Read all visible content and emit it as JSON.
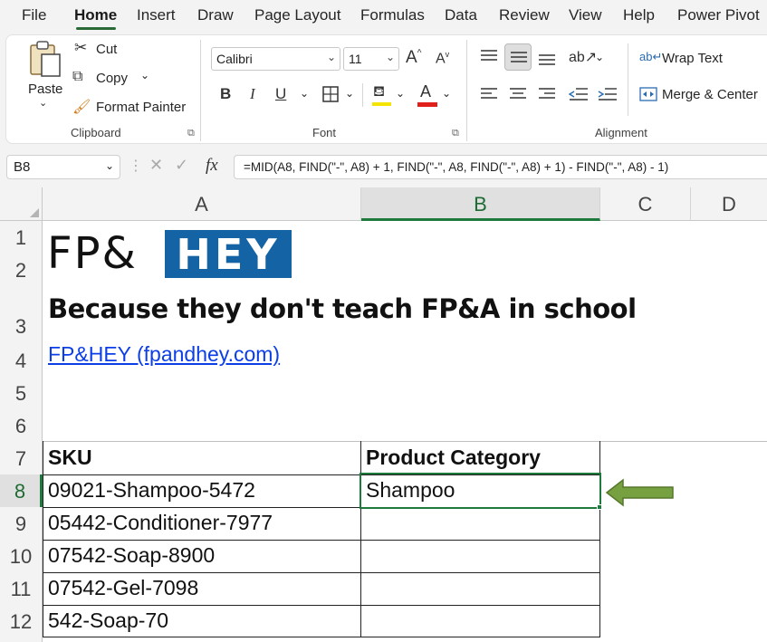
{
  "menu": {
    "tabs": [
      "File",
      "Home",
      "Insert",
      "Draw",
      "Page Layout",
      "Formulas",
      "Data",
      "Review",
      "View",
      "Help",
      "Power Pivot"
    ],
    "active": "Home"
  },
  "ribbon": {
    "clipboard": {
      "paste": "Paste",
      "cut": "Cut",
      "copy": "Copy",
      "format_painter": "Format Painter",
      "label": "Clipboard"
    },
    "font": {
      "name": "Calibri",
      "size": "11",
      "bold": "B",
      "italic": "I",
      "underline": "U",
      "font_color_letter": "A",
      "grow": "A",
      "shrink": "A",
      "label": "Font"
    },
    "alignment": {
      "wrap_text": "Wrap Text",
      "merge_center": "Merge & Center",
      "label": "Alignment"
    }
  },
  "formula_bar": {
    "name_box": "B8",
    "fx": "fx",
    "formula": "=MID(A8, FIND(\"-\", A8) + 1, FIND(\"-\", A8, FIND(\"-\", A8) + 1) - FIND(\"-\", A8) - 1)"
  },
  "columns": [
    "A",
    "B",
    "C",
    "D"
  ],
  "rows": [
    "1",
    "2",
    "3",
    "4",
    "5",
    "6",
    "7",
    "8",
    "9",
    "10",
    "11",
    "12"
  ],
  "sheet": {
    "logo_left": "FP&",
    "logo_right": "HEY",
    "tagline": "Because they don't teach FP&A in school",
    "link": "FP&HEY (fpandhey.com)",
    "table": {
      "headers": [
        "SKU",
        "Product Category"
      ],
      "rows": [
        [
          "09021-Shampoo-5472",
          "Shampoo"
        ],
        [
          "05442-Conditioner-7977",
          ""
        ],
        [
          "07542-Soap-8900",
          ""
        ],
        [
          "07542-Gel-7098",
          ""
        ],
        [
          "542-Soap-70",
          ""
        ]
      ]
    }
  },
  "colors": {
    "accent_green": "#1e7a3c",
    "logo_blue": "#1463a4",
    "arrow_fill": "#77a040",
    "link_blue": "#0b3ee6",
    "font_color_bar": "#e0201b"
  }
}
